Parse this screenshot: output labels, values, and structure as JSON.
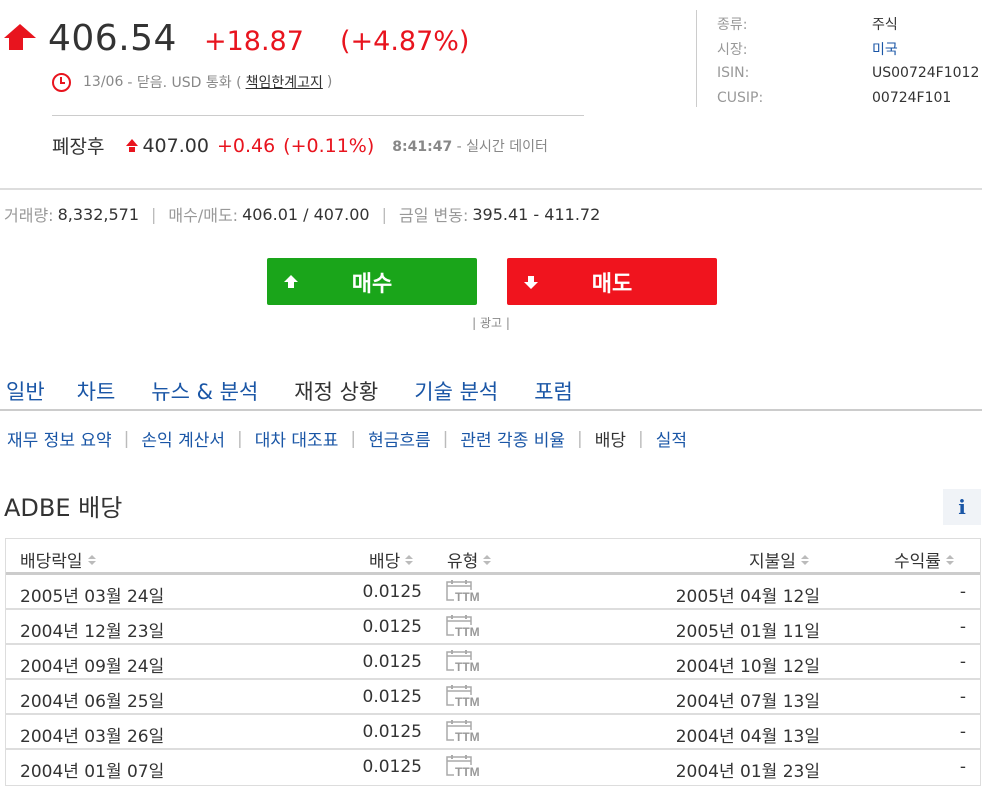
{
  "quote": {
    "price": "406.54",
    "change": "+18.87",
    "change_pct": "(+4.87%)",
    "status_date": "13/06",
    "status_text": "- 닫음. USD 통화 (",
    "disclaimer": "책임한계고지",
    "status_close": ")",
    "after_label": "폐장후",
    "after_price": "407.00",
    "after_change": "+0.46",
    "after_pct": "(+0.11%)",
    "after_time": "8:41:47",
    "after_time_text": "- 실시간 데이터"
  },
  "info": [
    {
      "key": "종류:",
      "value": "주식"
    },
    {
      "key": "시장:",
      "value": "미국"
    },
    {
      "key": "ISIN:",
      "value": "US00724F1012"
    },
    {
      "key": "CUSIP:",
      "value": "00724F101"
    }
  ],
  "stats": {
    "volume_label": "거래량:",
    "volume": "8,332,571",
    "bidask_label": "매수/매도:",
    "bidask": "406.01 / 407.00",
    "range_label": "금일 변동:",
    "range": "395.41 - 411.72"
  },
  "buttons": {
    "buy": "매수",
    "sell": "매도",
    "ad": "| 광고 |"
  },
  "tabs": [
    "일반",
    "차트",
    "뉴스 & 분석",
    "재정 상황",
    "기술 분석",
    "포럼"
  ],
  "subtabs": [
    "재무 정보 요약",
    "손익 계산서",
    "대차 대조표",
    "현금흐름",
    "관련 각종 비율",
    "배당",
    "실적"
  ],
  "section_title": "ADBE 배당",
  "info_icon": "i",
  "table": {
    "headers": [
      "배당락일",
      "배당",
      "유형",
      "지불일",
      "수익률"
    ],
    "rows": [
      {
        "ex_date": "2005년 03월 24일",
        "dividend": "0.0125",
        "type": "TTM",
        "pay_date": "2005년 04월 12일",
        "yield": "-"
      },
      {
        "ex_date": "2004년 12월 23일",
        "dividend": "0.0125",
        "type": "TTM",
        "pay_date": "2005년 01월 11일",
        "yield": "-"
      },
      {
        "ex_date": "2004년 09월 24일",
        "dividend": "0.0125",
        "type": "TTM",
        "pay_date": "2004년 10월 12일",
        "yield": "-"
      },
      {
        "ex_date": "2004년 06월 25일",
        "dividend": "0.0125",
        "type": "TTM",
        "pay_date": "2004년 07월 13일",
        "yield": "-"
      },
      {
        "ex_date": "2004년 03월 26일",
        "dividend": "0.0125",
        "type": "TTM",
        "pay_date": "2004년 04월 13일",
        "yield": "-"
      },
      {
        "ex_date": "2004년 01월 07일",
        "dividend": "0.0125",
        "type": "TTM",
        "pay_date": "2004년 01월 23일",
        "yield": "-"
      }
    ]
  },
  "colors": {
    "up": "#e8141e",
    "buy": "#1aa51a",
    "sell": "#f0141e",
    "link": "#1a56a6"
  }
}
